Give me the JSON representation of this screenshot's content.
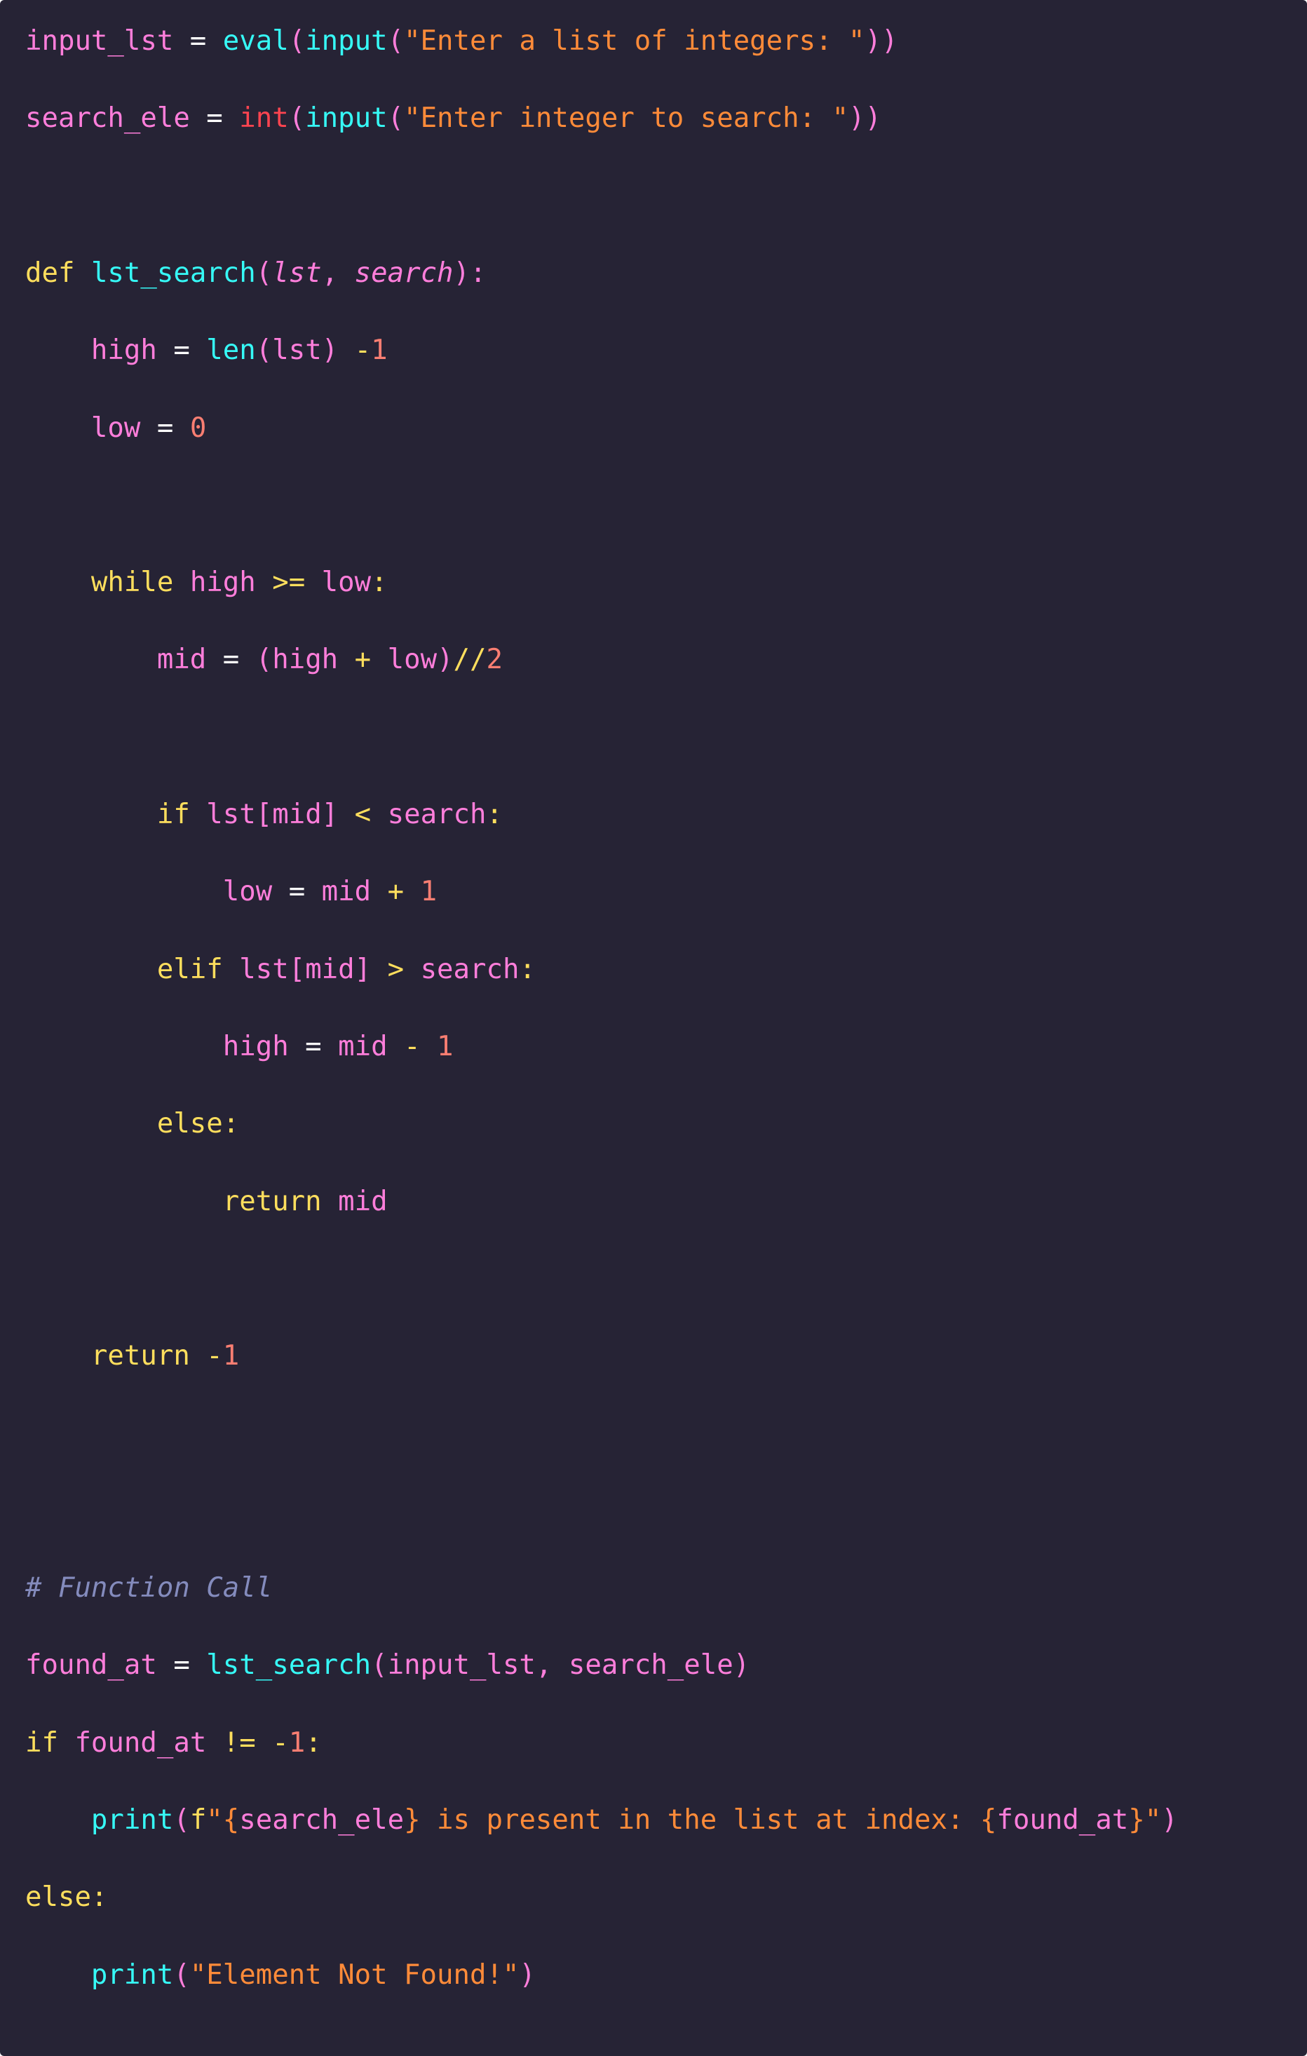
{
  "colors": {
    "background": "#262335",
    "variable": "#ff7edb",
    "keyword": "#fede5d",
    "function": "#36f9f6",
    "string": "#ff8b39",
    "number": "#f97e72",
    "builtin_type": "#fe4450",
    "comment": "#848bbd",
    "operator_assign": "#fefefe"
  },
  "lines": [
    {
      "indent": "",
      "tokens": [
        {
          "t": "input_lst",
          "c": "var"
        },
        {
          "t": " = ",
          "c": "eq"
        },
        {
          "t": "eval",
          "c": "fn"
        },
        {
          "t": "(",
          "c": "punct"
        },
        {
          "t": "input",
          "c": "fn"
        },
        {
          "t": "(",
          "c": "punct"
        },
        {
          "t": "\"Enter a list of integers: \"",
          "c": "str"
        },
        {
          "t": "))",
          "c": "punct"
        }
      ]
    },
    {
      "indent": "",
      "tokens": [
        {
          "t": "search_ele",
          "c": "var"
        },
        {
          "t": " = ",
          "c": "eq"
        },
        {
          "t": "int",
          "c": "type"
        },
        {
          "t": "(",
          "c": "punct"
        },
        {
          "t": "input",
          "c": "fn"
        },
        {
          "t": "(",
          "c": "punct"
        },
        {
          "t": "\"Enter integer to search: \"",
          "c": "str"
        },
        {
          "t": "))",
          "c": "punct"
        }
      ]
    },
    {
      "indent": "",
      "tokens": []
    },
    {
      "indent": "",
      "tokens": [
        {
          "t": "def",
          "c": "kw"
        },
        {
          "t": " ",
          "c": "eq"
        },
        {
          "t": "lst_search",
          "c": "fn"
        },
        {
          "t": "(",
          "c": "punct"
        },
        {
          "t": "lst",
          "c": "param"
        },
        {
          "t": ", ",
          "c": "punct"
        },
        {
          "t": "search",
          "c": "param"
        },
        {
          "t": "):",
          "c": "punct"
        }
      ]
    },
    {
      "indent": "    ",
      "tokens": [
        {
          "t": "high",
          "c": "var"
        },
        {
          "t": " = ",
          "c": "eq"
        },
        {
          "t": "len",
          "c": "fn"
        },
        {
          "t": "(",
          "c": "punct"
        },
        {
          "t": "lst",
          "c": "var"
        },
        {
          "t": ")",
          "c": "punct"
        },
        {
          "t": " -",
          "c": "op"
        },
        {
          "t": "1",
          "c": "num"
        }
      ]
    },
    {
      "indent": "    ",
      "tokens": [
        {
          "t": "low",
          "c": "var"
        },
        {
          "t": " = ",
          "c": "eq"
        },
        {
          "t": "0",
          "c": "num"
        }
      ]
    },
    {
      "indent": "",
      "tokens": []
    },
    {
      "indent": "    ",
      "tokens": [
        {
          "t": "while",
          "c": "kw"
        },
        {
          "t": " ",
          "c": "eq"
        },
        {
          "t": "high",
          "c": "var"
        },
        {
          "t": " >= ",
          "c": "op"
        },
        {
          "t": "low",
          "c": "var"
        },
        {
          "t": ":",
          "c": "op"
        }
      ]
    },
    {
      "indent": "        ",
      "tokens": [
        {
          "t": "mid",
          "c": "var"
        },
        {
          "t": " = ",
          "c": "eq"
        },
        {
          "t": "(",
          "c": "punct"
        },
        {
          "t": "high",
          "c": "var"
        },
        {
          "t": " + ",
          "c": "op"
        },
        {
          "t": "low",
          "c": "var"
        },
        {
          "t": ")",
          "c": "punct"
        },
        {
          "t": "//",
          "c": "op"
        },
        {
          "t": "2",
          "c": "num"
        }
      ]
    },
    {
      "indent": "",
      "tokens": []
    },
    {
      "indent": "        ",
      "tokens": [
        {
          "t": "if",
          "c": "kw"
        },
        {
          "t": " ",
          "c": "eq"
        },
        {
          "t": "lst",
          "c": "var"
        },
        {
          "t": "[",
          "c": "punct"
        },
        {
          "t": "mid",
          "c": "var"
        },
        {
          "t": "]",
          "c": "punct"
        },
        {
          "t": " < ",
          "c": "op"
        },
        {
          "t": "search",
          "c": "var"
        },
        {
          "t": ":",
          "c": "op"
        }
      ]
    },
    {
      "indent": "            ",
      "tokens": [
        {
          "t": "low",
          "c": "var"
        },
        {
          "t": " = ",
          "c": "eq"
        },
        {
          "t": "mid",
          "c": "var"
        },
        {
          "t": " + ",
          "c": "op"
        },
        {
          "t": "1",
          "c": "num"
        }
      ]
    },
    {
      "indent": "        ",
      "tokens": [
        {
          "t": "elif",
          "c": "kw"
        },
        {
          "t": " ",
          "c": "eq"
        },
        {
          "t": "lst",
          "c": "var"
        },
        {
          "t": "[",
          "c": "punct"
        },
        {
          "t": "mid",
          "c": "var"
        },
        {
          "t": "]",
          "c": "punct"
        },
        {
          "t": " > ",
          "c": "op"
        },
        {
          "t": "search",
          "c": "var"
        },
        {
          "t": ":",
          "c": "op"
        }
      ]
    },
    {
      "indent": "            ",
      "tokens": [
        {
          "t": "high",
          "c": "var"
        },
        {
          "t": " = ",
          "c": "eq"
        },
        {
          "t": "mid",
          "c": "var"
        },
        {
          "t": " - ",
          "c": "op"
        },
        {
          "t": "1",
          "c": "num"
        }
      ]
    },
    {
      "indent": "        ",
      "tokens": [
        {
          "t": "else",
          "c": "kw"
        },
        {
          "t": ":",
          "c": "op"
        }
      ]
    },
    {
      "indent": "            ",
      "tokens": [
        {
          "t": "return",
          "c": "kw"
        },
        {
          "t": " ",
          "c": "eq"
        },
        {
          "t": "mid",
          "c": "var"
        }
      ]
    },
    {
      "indent": "",
      "tokens": []
    },
    {
      "indent": "    ",
      "tokens": [
        {
          "t": "return",
          "c": "kw"
        },
        {
          "t": " -",
          "c": "op"
        },
        {
          "t": "1",
          "c": "num"
        }
      ]
    },
    {
      "indent": "",
      "tokens": []
    },
    {
      "indent": "",
      "tokens": []
    },
    {
      "indent": "",
      "tokens": [
        {
          "t": "# Function Call",
          "c": "comment"
        }
      ]
    },
    {
      "indent": "",
      "tokens": [
        {
          "t": "found_at",
          "c": "var"
        },
        {
          "t": " = ",
          "c": "eq"
        },
        {
          "t": "lst_search",
          "c": "fn"
        },
        {
          "t": "(",
          "c": "punct"
        },
        {
          "t": "input_lst",
          "c": "var"
        },
        {
          "t": ", ",
          "c": "punct"
        },
        {
          "t": "search_ele",
          "c": "var"
        },
        {
          "t": ")",
          "c": "punct"
        }
      ]
    },
    {
      "indent": "",
      "tokens": [
        {
          "t": "if",
          "c": "kw"
        },
        {
          "t": " ",
          "c": "eq"
        },
        {
          "t": "found_at",
          "c": "var"
        },
        {
          "t": " != ",
          "c": "op"
        },
        {
          "t": "-",
          "c": "op"
        },
        {
          "t": "1",
          "c": "num"
        },
        {
          "t": ":",
          "c": "op"
        }
      ]
    },
    {
      "indent": "    ",
      "tokens": [
        {
          "t": "print",
          "c": "fn"
        },
        {
          "t": "(",
          "c": "punct"
        },
        {
          "t": "f",
          "c": "kw"
        },
        {
          "t": "\"",
          "c": "str"
        },
        {
          "t": "{",
          "c": "str"
        },
        {
          "t": "search_ele",
          "c": "var"
        },
        {
          "t": "}",
          "c": "str"
        },
        {
          "t": " is present in the list at index: ",
          "c": "str"
        },
        {
          "t": "{",
          "c": "str"
        },
        {
          "t": "found_at",
          "c": "var"
        },
        {
          "t": "}",
          "c": "str"
        },
        {
          "t": "\"",
          "c": "str"
        },
        {
          "t": ")",
          "c": "punct"
        }
      ]
    },
    {
      "indent": "",
      "tokens": [
        {
          "t": "else",
          "c": "kw"
        },
        {
          "t": ":",
          "c": "op"
        }
      ]
    },
    {
      "indent": "    ",
      "tokens": [
        {
          "t": "print",
          "c": "fn"
        },
        {
          "t": "(",
          "c": "punct"
        },
        {
          "t": "\"Element Not Found!\"",
          "c": "str"
        },
        {
          "t": ")",
          "c": "punct"
        }
      ]
    }
  ]
}
